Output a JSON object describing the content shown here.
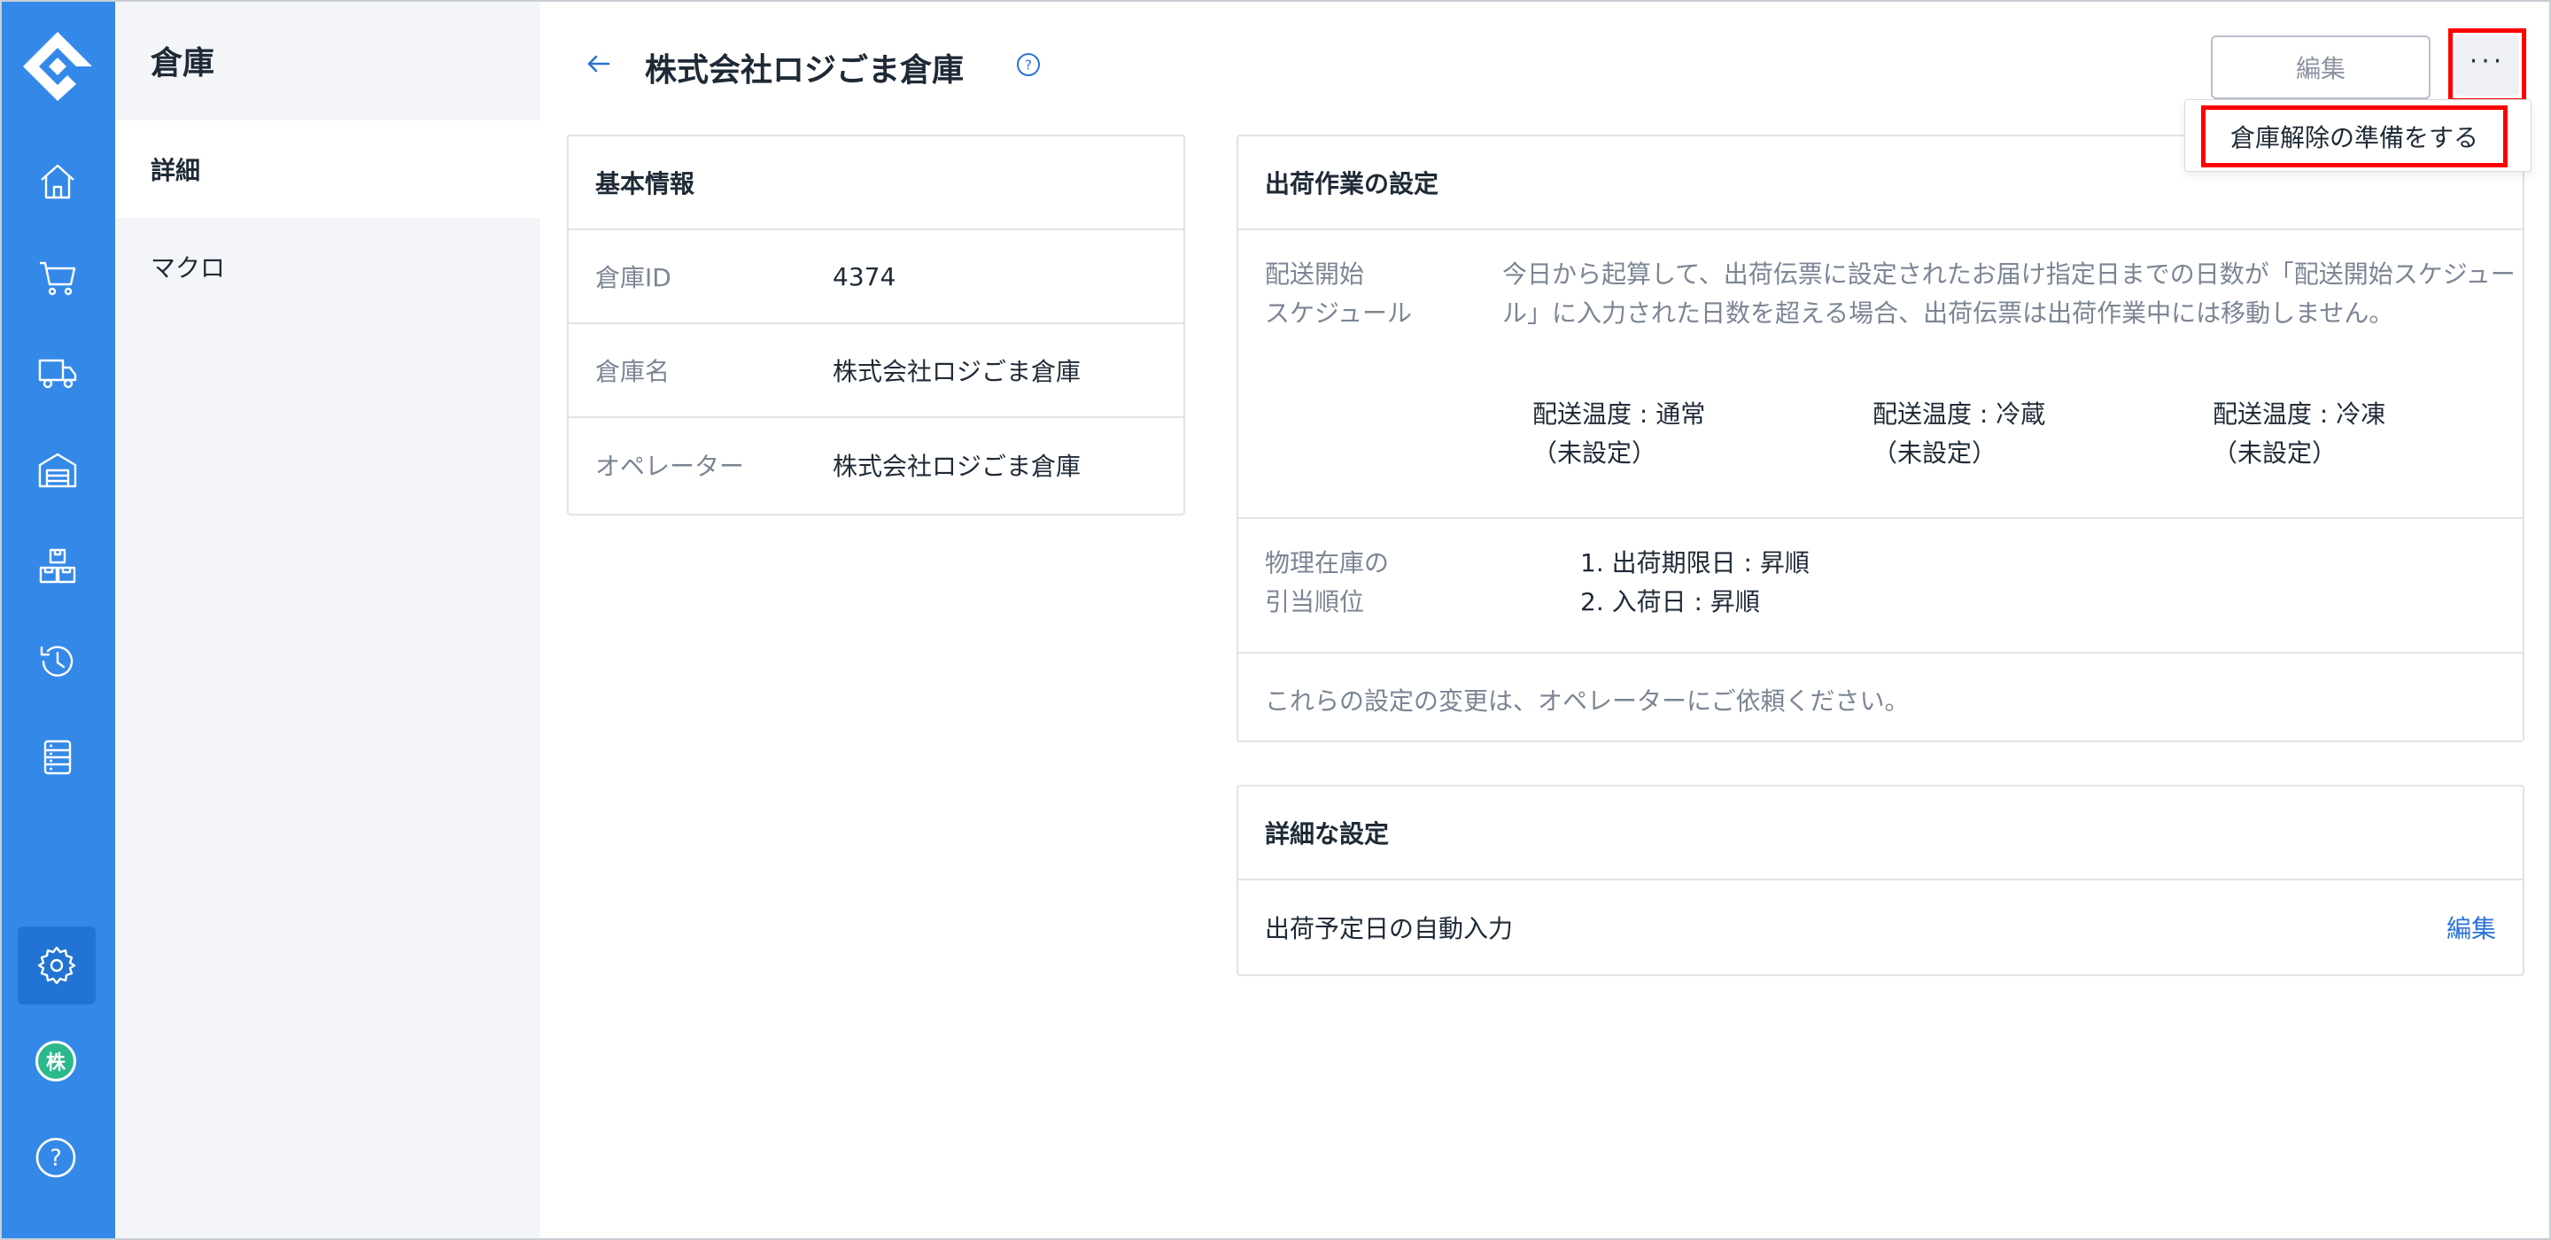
{
  "sidebar_rail": {
    "icons": [
      "logo-icon",
      "home-icon",
      "cart-icon",
      "truck-icon",
      "warehouse-icon",
      "boxes-icon",
      "history-icon",
      "list-icon",
      "gear-icon",
      "avatar",
      "help-icon"
    ],
    "avatar_text": "株",
    "help_text": "?"
  },
  "subnav": {
    "title": "倉庫",
    "items": [
      {
        "label": "詳細",
        "active": true
      },
      {
        "label": "マクロ",
        "active": false
      }
    ]
  },
  "header": {
    "title": "株式会社ロジごま倉庫",
    "edit_label": "編集",
    "more_label": "···",
    "dropdown_option": "倉庫解除の準備をする"
  },
  "basic_info": {
    "heading": "基本情報",
    "rows": [
      {
        "key": "倉庫ID",
        "value": "4374"
      },
      {
        "key": "倉庫名",
        "value": "株式会社ロジごま倉庫"
      },
      {
        "key": "オペレーター",
        "value": "株式会社ロジごま倉庫"
      }
    ]
  },
  "shipping": {
    "heading": "出荷作業の設定",
    "schedule_label_line1": "配送開始",
    "schedule_label_line2": "スケジュール",
    "schedule_desc": "今日から起算して、出荷伝票に設定されたお届け指定日までの日数が「配送開始スケジュール」に入力された日数を超える場合、出荷伝票は出荷作業中には移動しません。",
    "temps": [
      {
        "label": "配送温度 : 通常",
        "value": "（未設定）"
      },
      {
        "label": "配送温度 : 冷蔵",
        "value": "（未設定）"
      },
      {
        "label": "配送温度 : 冷凍",
        "value": "（未設定）"
      }
    ],
    "alloc_label_line1": "物理在庫の",
    "alloc_label_line2": "引当順位",
    "alloc_items": [
      "1. 出荷期限日 : 昇順",
      "2. 入荷日 : 昇順"
    ],
    "note": "これらの設定の変更は、オペレーターにご依頼ください。"
  },
  "advanced": {
    "heading": "詳細な設定",
    "row_label": "出荷予定日の自動入力",
    "row_link": "編集"
  },
  "colors": {
    "rail": "#3489e8",
    "rail_active": "#2274d4",
    "highlight": "#ff0000",
    "link": "#2a72d8"
  }
}
